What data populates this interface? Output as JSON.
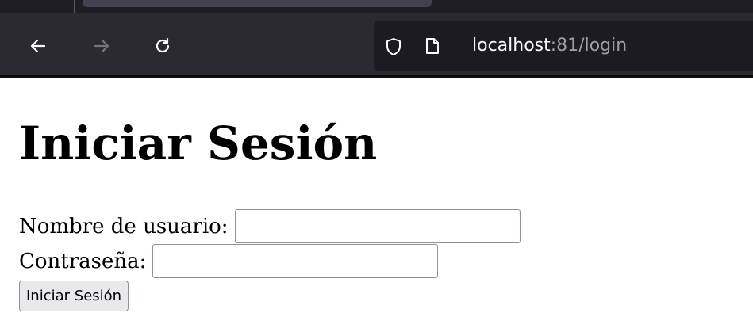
{
  "browser": {
    "url_host": "localhost",
    "url_rest": ":81/login",
    "icons": {
      "back": "arrow-left-icon",
      "forward": "arrow-right-icon",
      "reload": "reload-icon",
      "security": "shield-icon",
      "page": "page-icon"
    }
  },
  "page": {
    "title": "Iniciar Sesión",
    "form": {
      "username_label": "Nombre de usuario:",
      "username_value": "",
      "password_label": "Contraseña:",
      "password_value": "",
      "submit_label": "Iniciar Sesión"
    }
  }
}
